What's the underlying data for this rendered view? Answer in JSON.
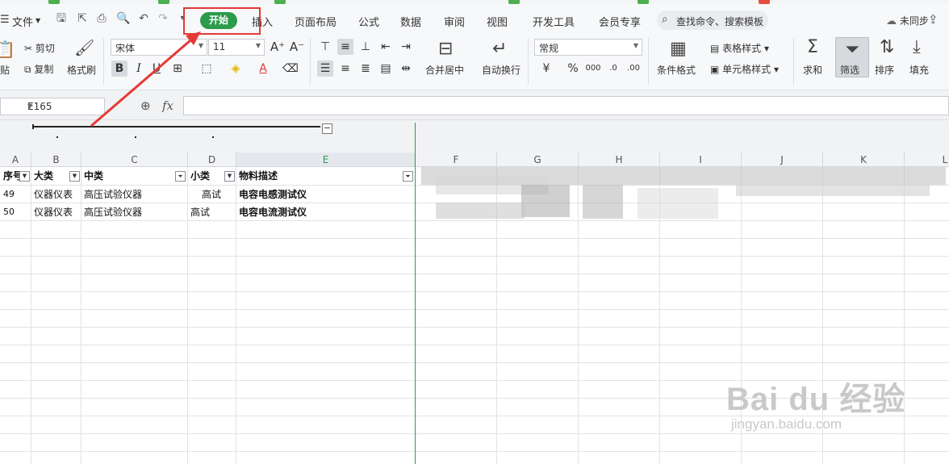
{
  "menu": {
    "file": "文件",
    "tabs": [
      "开始",
      "插入",
      "页面布局",
      "公式",
      "数据",
      "审阅",
      "视图",
      "开发工具",
      "会员专享"
    ],
    "search_placeholder": "查找命令、搜索模板",
    "sync": "未同步"
  },
  "ribbon": {
    "cut": "剪切",
    "paste": "贴",
    "copy": "复制",
    "format_painter": "格式刷",
    "font_name": "宋体",
    "font_size": "11",
    "merge_center": "合并居中",
    "wrap_text": "自动换行",
    "number_format": "常规",
    "table_style": "表格样式",
    "cell_style": "单元格样式",
    "conditional_format": "条件格式",
    "sum": "求和",
    "filter": "筛选",
    "sort": "排序",
    "fill": "填充"
  },
  "formula_bar": {
    "name_box": "E165",
    "fx": "fx"
  },
  "columns": [
    "A",
    "B",
    "C",
    "D",
    "E",
    "F",
    "G",
    "H",
    "I",
    "J",
    "K",
    "L"
  ],
  "header_row": [
    "序号",
    "大类",
    "中类",
    "小类",
    "物料描述"
  ],
  "rows": [
    [
      "49",
      "仪器仪表",
      "高压试验仪器",
      "高试",
      "电容电感测试仪"
    ],
    [
      "50",
      "仪器仪表",
      "高压试验仪器",
      "高试",
      "电容电流测试仪"
    ]
  ],
  "watermark": {
    "logo": "Bai du 经验",
    "url": "jingyan.baidu.com"
  }
}
